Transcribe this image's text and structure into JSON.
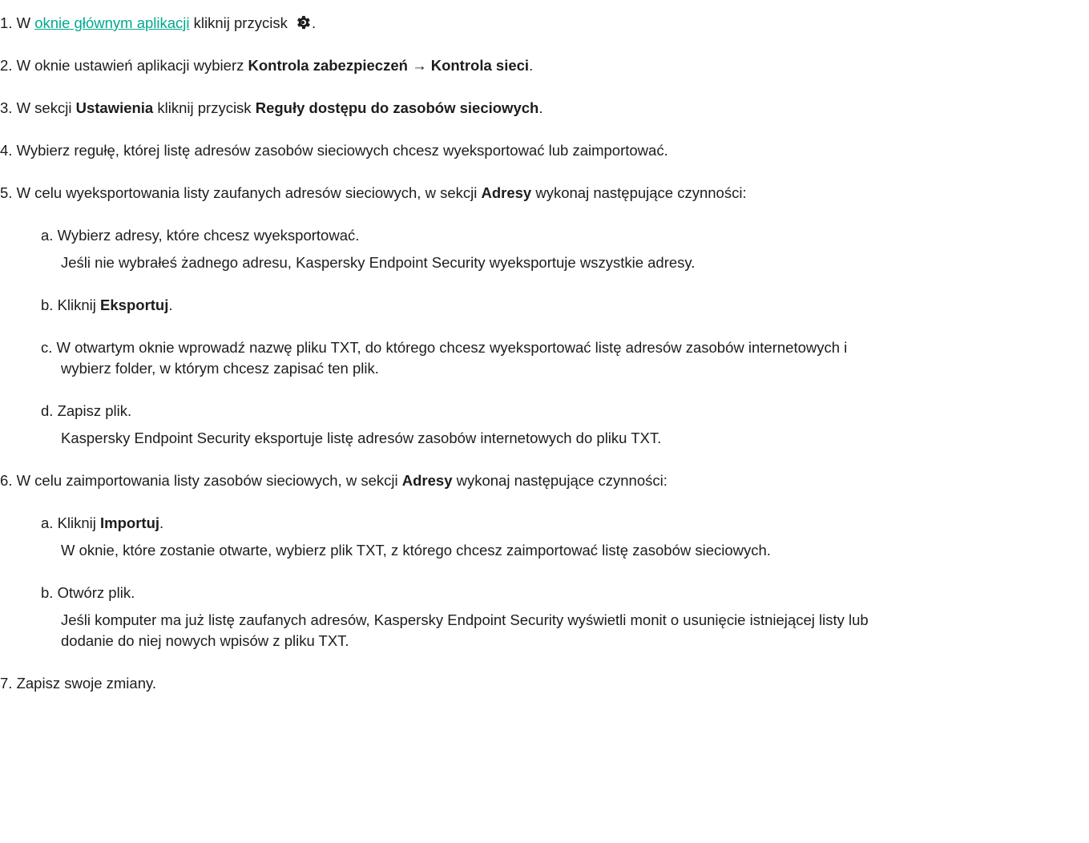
{
  "steps": [
    {
      "num": "1.",
      "pre": " W ",
      "link": "oknie głównym aplikacji",
      "post": " kliknij przycisk ",
      "icon": "gear-icon",
      "end": "."
    },
    {
      "num": "2.",
      "pre": " W oknie ustawień aplikacji wybierz ",
      "bold1": "Kontrola zabezpieczeń",
      "arrow": " → ",
      "bold2": "Kontrola sieci",
      "end": "."
    },
    {
      "num": "3.",
      "pre": " W sekcji ",
      "bold1": "Ustawienia",
      "mid": " kliknij przycisk ",
      "bold2": "Reguły dostępu do zasobów sieciowych",
      "end": "."
    },
    {
      "num": "4.",
      "text": " Wybierz regułę, której listę adresów zasobów sieciowych chcesz wyeksportować lub zaimportować."
    },
    {
      "num": "5.",
      "pre": " W celu wyeksportowania listy zaufanych adresów sieciowych, w sekcji ",
      "bold1": "Adresy",
      "post": " wykonaj następujące czynności:",
      "sub": [
        {
          "letter": "a.",
          "text": " Wybierz adresy, które chcesz wyeksportować.",
          "note": "Jeśli nie wybrałeś żadnego adresu, Kaspersky Endpoint Security wyeksportuje wszystkie adresy."
        },
        {
          "letter": "b.",
          "pre": " Kliknij ",
          "bold": "Eksportuj",
          "end": "."
        },
        {
          "letter": "c.",
          "text1": " W otwartym oknie wprowadź nazwę pliku TXT, do którego chcesz wyeksportować listę adresów zasobów internetowych i",
          "text2": "wybierz folder, w którym chcesz zapisać ten plik."
        },
        {
          "letter": "d.",
          "text": " Zapisz plik.",
          "note": "Kaspersky Endpoint Security eksportuje listę adresów zasobów internetowych do pliku TXT."
        }
      ]
    },
    {
      "num": "6.",
      "pre": " W celu zaimportowania listy zasobów sieciowych, w sekcji ",
      "bold1": "Adresy",
      "post": " wykonaj następujące czynności:",
      "sub": [
        {
          "letter": "a.",
          "pre": " Kliknij ",
          "bold": "Importuj",
          "end": ".",
          "note": "W oknie, które zostanie otwarte, wybierz plik TXT, z którego chcesz zaimportować listę zasobów sieciowych."
        },
        {
          "letter": "b.",
          "text": " Otwórz plik.",
          "note1": "Jeśli komputer ma już listę zaufanych adresów, Kaspersky Endpoint Security wyświetli monit o usunięcie istniejącej listy lub",
          "note2": "dodanie do niej nowych wpisów z pliku TXT."
        }
      ]
    },
    {
      "num": "7.",
      "text": " Zapisz swoje zmiany."
    }
  ],
  "colors": {
    "text": "#1d1d1b",
    "link": "#00a88e",
    "icon": "#1d1d1b"
  }
}
